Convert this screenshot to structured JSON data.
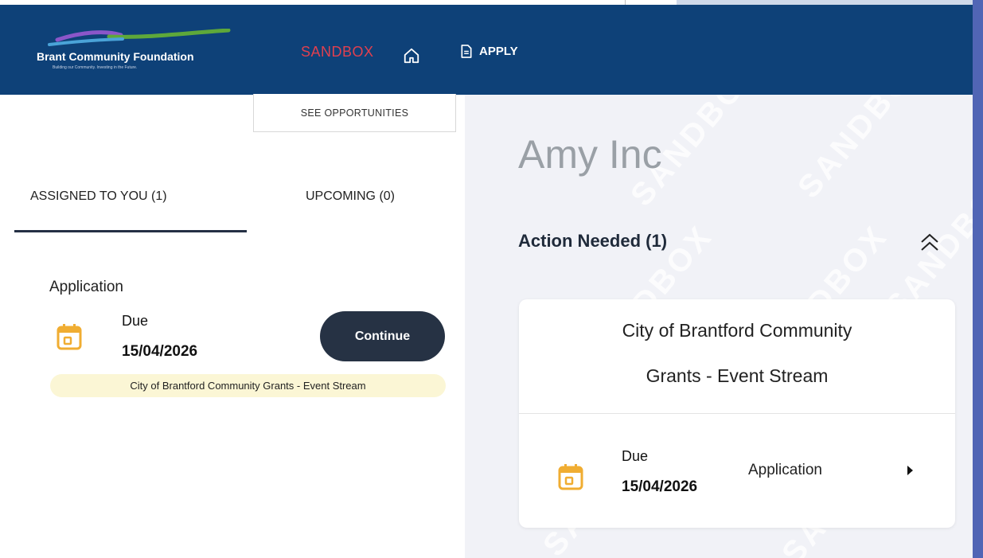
{
  "header": {
    "logo": {
      "name": "Brant Community Foundation",
      "tagline": "Building our Community. Investing in the Future."
    },
    "environment_label": "SANDBOX",
    "home_icon": "home-icon",
    "apply_label": "APPLY",
    "apply_icon": "document-icon"
  },
  "left": {
    "see_opportunities": "SEE OPPORTUNITIES",
    "tabs": [
      {
        "label": "ASSIGNED TO YOU (1)",
        "active": true
      },
      {
        "label": "UPCOMING (0)",
        "active": false
      }
    ],
    "task": {
      "type": "Application",
      "due_label": "Due",
      "due_date": "15/04/2026",
      "button_label": "Continue",
      "program": "City of Brantford Community Grants - Event Stream",
      "icon": "calendar-icon"
    }
  },
  "right": {
    "organization": "Amy Inc",
    "section_title": "Action Needed (1)",
    "collapse_icon": "double-chevron-up-icon",
    "watermark_text": "SANDBOX",
    "card": {
      "title_line1": "City of Brantford Community",
      "title_line2": "Grants - Event Stream",
      "due_label": "Due",
      "due_date": "15/04/2026",
      "task_label": "Application",
      "icon": "calendar-icon",
      "arrow_icon": "caret-right-icon"
    }
  },
  "colors": {
    "header_bg": "#0e4178",
    "sandbox": "#e0404f",
    "calendar": "#f0ad32",
    "button_bg": "#263244",
    "pill_bg": "#fbf6d5",
    "panel_bg": "#f1f2f7"
  }
}
